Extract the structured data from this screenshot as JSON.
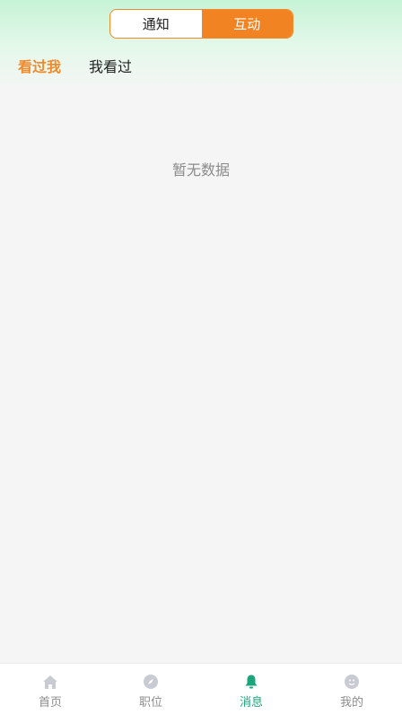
{
  "segment": {
    "tabs": [
      {
        "label": "通知",
        "active": false
      },
      {
        "label": "互动",
        "active": true
      }
    ]
  },
  "subtabs": [
    {
      "label": "看过我",
      "active": true
    },
    {
      "label": "我看过",
      "active": false
    }
  ],
  "empty_state": {
    "text": "暂无数据"
  },
  "bottom_nav": {
    "items": [
      {
        "label": "首页",
        "icon": "home-icon",
        "active": false
      },
      {
        "label": "职位",
        "icon": "compass-icon",
        "active": false
      },
      {
        "label": "消息",
        "icon": "bell-icon",
        "active": true
      },
      {
        "label": "我的",
        "icon": "profile-icon",
        "active": false
      }
    ]
  },
  "colors": {
    "accent_orange": "#f28322",
    "active_green": "#1aa57a",
    "inactive_gray": "#8c8c8c"
  }
}
